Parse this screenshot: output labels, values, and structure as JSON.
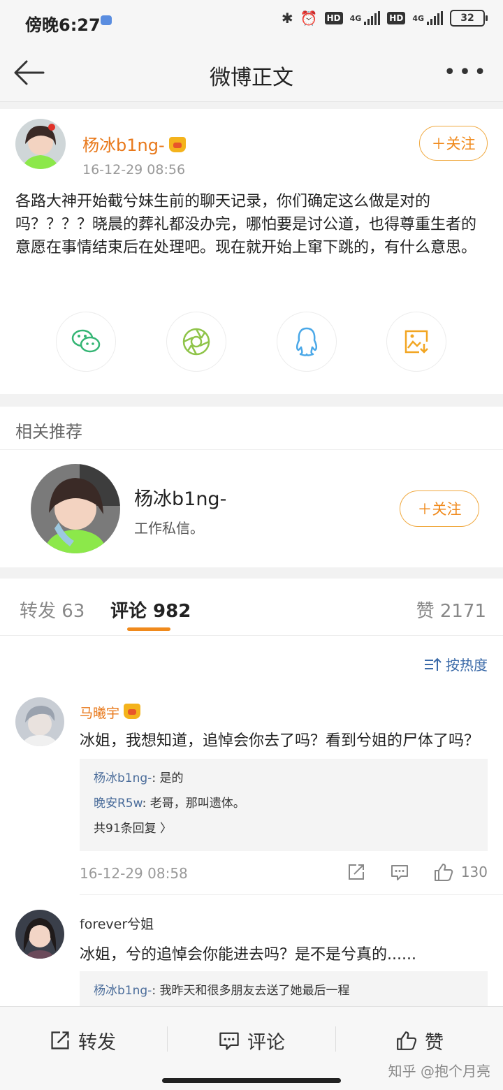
{
  "status": {
    "time": "傍晚6:27",
    "hd1": "HD",
    "net1": "4G",
    "hd2": "HD",
    "net2": "4G",
    "battery": "32"
  },
  "nav": {
    "title": "微博正文"
  },
  "post": {
    "author": "杨冰b1ng-",
    "time": "16-12-29 08:56",
    "follow_label": "＋关注",
    "text": "各路大神开始截兮妹生前的聊天记录，你们确定这么做是对的吗？？？？晓晨的葬礼都没办完，哪怕要是讨公道，也得尊重生者的意愿在事情结束后在处理吧。现在就开始上窜下跳的，有什么意思。"
  },
  "related": {
    "heading": "相关推荐",
    "name": "杨冰b1ng-",
    "desc": "工作私信。",
    "follow_label": "＋关注"
  },
  "tabs": {
    "repost": "转发 63",
    "comment": "评论 982",
    "like": "赞 2171"
  },
  "sort_label": "按热度",
  "comments": [
    {
      "name": "马曦宇",
      "text": "冰姐，我想知道，追悼会你去了吗？看到兮姐的尸体了吗？",
      "replies": [
        {
          "name": "杨冰b1ng-",
          "text": ": 是的"
        },
        {
          "name": "晚安R5w",
          "text": ": 老哥，那叫遗体。"
        }
      ],
      "more_replies": "共91条回复 〉",
      "time": "16-12-29 08:58",
      "likes": "130"
    },
    {
      "name": "forever兮姐",
      "text": "冰姐，兮的追悼会你能进去吗？是不是兮真的......",
      "replies": [
        {
          "name": "杨冰b1ng-",
          "text": ": 我昨天和很多朋友去送了她最后一程"
        }
      ]
    }
  ],
  "bottom": {
    "repost": "转发",
    "comment": "评论",
    "like": "赞"
  },
  "watermark": "知乎 @抱个月亮",
  "colors": {
    "accent": "#f08a1c",
    "link": "#4a6c9a",
    "wechat": "#34b574",
    "moments": "#8fc449",
    "qq": "#4aa8e8",
    "save": "#f2a623"
  }
}
